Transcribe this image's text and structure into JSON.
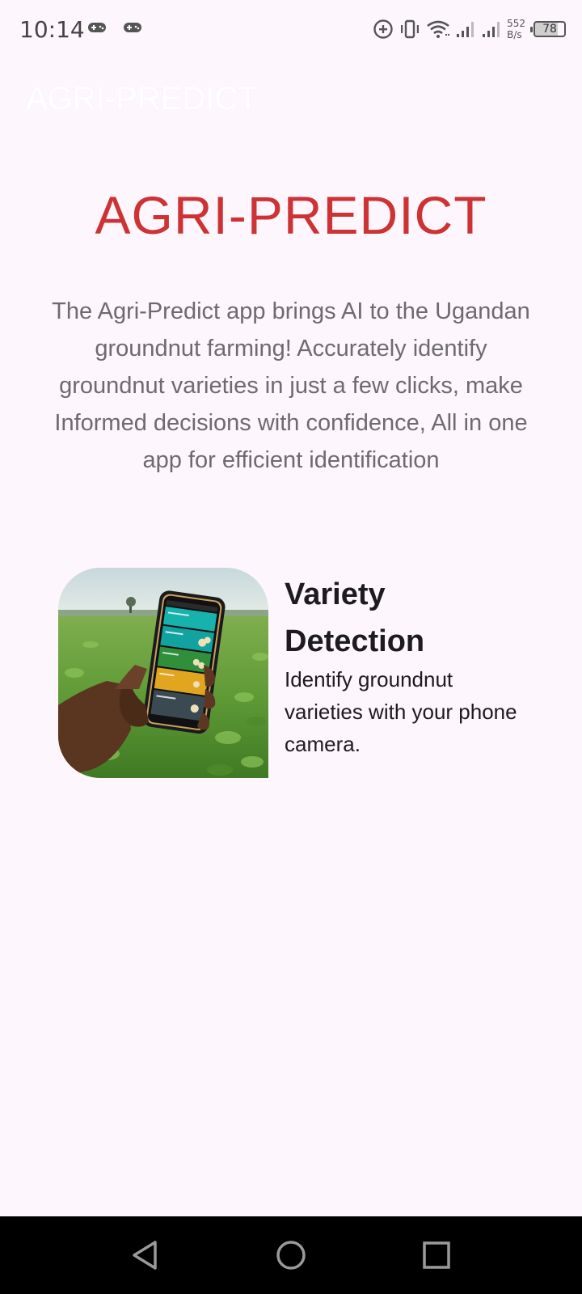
{
  "status_bar": {
    "time": "10:14",
    "net_speed_value": "552",
    "net_speed_unit": "B/s",
    "battery_level": "78",
    "icons": [
      "gamepad-icon",
      "gamepad-icon",
      "data-saver-icon",
      "vibrate-icon",
      "wifi-icon",
      "signal-icon",
      "signal-icon",
      "battery-icon"
    ]
  },
  "app_bar": {
    "title": "AGRI-PREDICT"
  },
  "main": {
    "hero_title": "AGRI-PREDICT",
    "description": "The Agri-Predict app brings AI to the Ugandan groundnut farming! Accurately identify groundnut varieties in just a few clicks, make Informed decisions with confidence, All in one app for efficient identification",
    "features": [
      {
        "title": "Variety Detection",
        "description": "Identify groundnut varieties with your phone camera."
      }
    ]
  },
  "nav_bar": {
    "icons": [
      "back-icon",
      "home-icon",
      "recents-icon"
    ]
  },
  "colors": {
    "background": "#fdf6fd",
    "hero_title": "#cd3335",
    "description_text": "#6d6a70",
    "feature_text": "#1d1b20",
    "nav_bar": "#000000"
  }
}
